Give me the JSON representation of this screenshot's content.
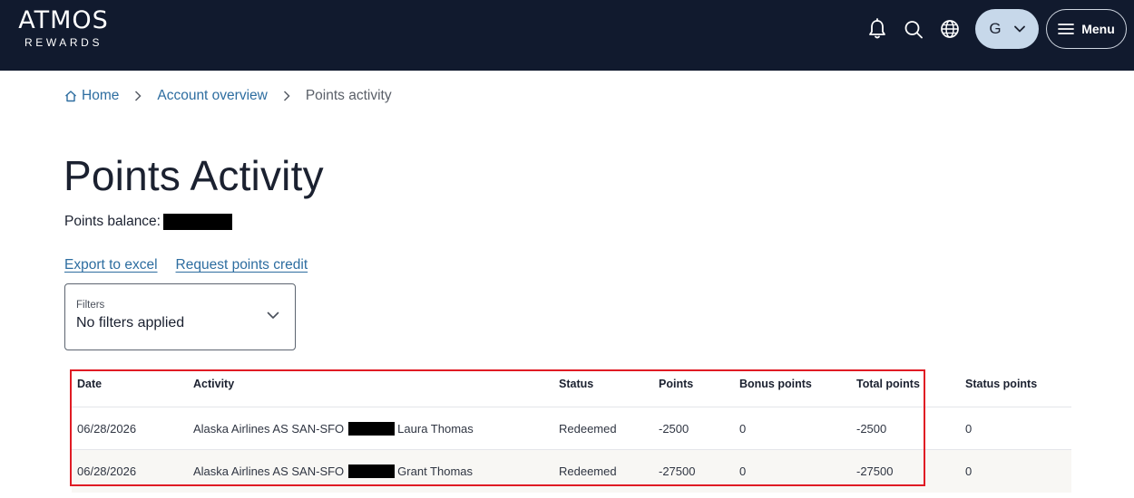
{
  "header": {
    "logo_main": "ATMOS",
    "logo_sub": "REWARDS",
    "icons": [
      "bell-icon",
      "search-icon",
      "globe-icon"
    ],
    "avatar_initial": "G",
    "menu_label": "Menu"
  },
  "breadcrumb": {
    "home": "Home",
    "account": "Account overview",
    "current": "Points activity"
  },
  "page": {
    "title": "Points Activity",
    "balance_label": "Points balance:"
  },
  "actions": {
    "export": "Export to excel",
    "request": "Request points credit"
  },
  "filters": {
    "label": "Filters",
    "value": "No filters applied"
  },
  "table": {
    "headers": {
      "date": "Date",
      "activity": "Activity",
      "status": "Status",
      "points": "Points",
      "bonus": "Bonus points",
      "total": "Total points",
      "status_points": "Status points"
    },
    "rows": [
      {
        "date": "06/28/2026",
        "activity": "Alaska Airlines AS SAN-SFO",
        "passenger": "Laura Thomas",
        "status": "Redeemed",
        "points": "-2500",
        "bonus": "0",
        "total": "-2500",
        "status_points": "0"
      },
      {
        "date": "06/28/2026",
        "activity": "Alaska Airlines AS SAN-SFO",
        "passenger": "Grant Thomas",
        "status": "Redeemed",
        "points": "-27500",
        "bonus": "0",
        "total": "-27500",
        "status_points": "0"
      }
    ]
  },
  "colors": {
    "header_bg": "#111a2e",
    "link": "#2d6da0",
    "avatar_bg": "#c7d8ea",
    "highlight": "#e01b24"
  }
}
